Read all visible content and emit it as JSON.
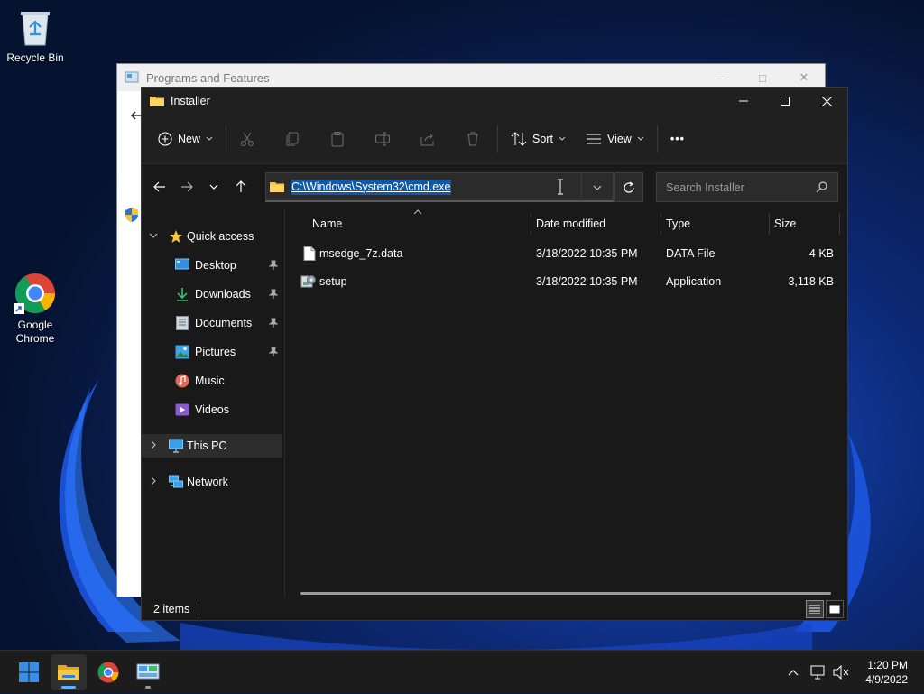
{
  "desktop": {
    "icons": [
      {
        "label": "Recycle Bin"
      },
      {
        "label": "Google Chrome"
      }
    ]
  },
  "bg_window": {
    "title": "Programs and Features"
  },
  "explorer": {
    "title": "Installer",
    "toolbar": {
      "new_label": "New",
      "sort_label": "Sort",
      "view_label": "View",
      "more_label": "•••"
    },
    "address": {
      "path": "C:\\Windows\\System32\\cmd.exe"
    },
    "search": {
      "placeholder": "Search Installer"
    },
    "nav": {
      "quick_access": "Quick access",
      "items": [
        {
          "label": "Desktop"
        },
        {
          "label": "Downloads"
        },
        {
          "label": "Documents"
        },
        {
          "label": "Pictures"
        },
        {
          "label": "Music"
        },
        {
          "label": "Videos"
        }
      ],
      "this_pc": "This PC",
      "network": "Network"
    },
    "columns": {
      "name": "Name",
      "date": "Date modified",
      "type": "Type",
      "size": "Size"
    },
    "files": [
      {
        "name": "msedge_7z.data",
        "date": "3/18/2022 10:35 PM",
        "type": "DATA File",
        "size": "4 KB"
      },
      {
        "name": "setup",
        "date": "3/18/2022 10:35 PM",
        "type": "Application",
        "size": "3,118 KB"
      }
    ],
    "status": {
      "count": "2 items"
    }
  },
  "taskbar": {
    "time": "1:20 PM",
    "date": "4/9/2022"
  },
  "colors": {
    "accent": "#0f5aa8",
    "folder": "#f8c640",
    "windows_blue": "#3a8ee6"
  }
}
